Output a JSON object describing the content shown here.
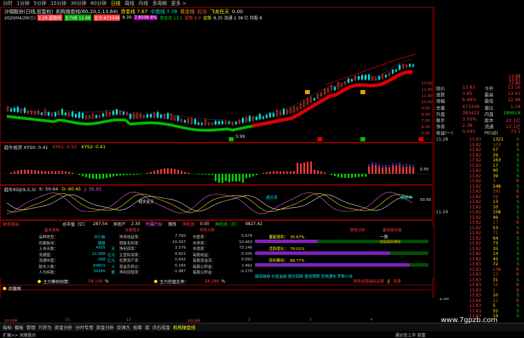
{
  "toolbar": {
    "items": [
      "分时",
      "1分钟",
      "5分钟",
      "15分钟",
      "30分钟",
      "60分钟",
      "日线",
      "周线",
      "月线",
      "多周期",
      "更多 >"
    ],
    "active": "日线"
  },
  "chart_header": {
    "line1_a": "沙钢股份(日线,前复权)",
    "line1_b": "机构操盘线(60,20,1,13,64)",
    "line1_c": "资金线 7.67",
    "line1_d": "中盘线 7.78",
    "line1_e": "黄金线",
    "line1_f": "起涨",
    "line1_g": "飞龙在天",
    "line1_h": "0.00",
    "line2_date": "2020/04/29(三)",
    "line2_a": "2.29 超级线 ",
    "line2_b": "主力线 11.98",
    "line2_c": "主力 673349",
    "line2_d": "8.39",
    "line2_e": "7.8598 8%",
    "line2_f": "资金流 13.1",
    "line2_g": "超叛 6.0",
    "line2_h": "金叛",
    "line2_i": "8.35 流通 2.38 亿 持股 8"
  },
  "price_axis": [
    "13.00",
    "12.00",
    "11.00",
    "10.00",
    "9.00",
    "8.00",
    "7.00",
    "6.00",
    "5.00"
  ],
  "main_annotations": {
    "bottom_label": "5.99",
    "markers": [
      "吸",
      "买",
      "卖",
      "买",
      "卖"
    ]
  },
  "pane2": {
    "header_a": "趋牛抢货 XYS0: 0.41",
    "header_b": "XYS1: 0.52",
    "header_c": "XYS2: 0.41",
    "axis": [
      "0.50",
      "1.00",
      "0.00"
    ]
  },
  "pane3": {
    "header_a": "趋牛KDJ(9,3,3)",
    "header_b": "K: 50.64",
    "header_c": "D: 60.45",
    "header_d": "J: 35.01",
    "labels": [
      "超卖金叉",
      "超卖金叉",
      "超买卖"
    ],
    "axis": [
      "100",
      "50.00",
      "0"
    ]
  },
  "finance": {
    "title": "财务指标",
    "total_shares": "总市值（亿）",
    "total_shares_v": "287.54",
    "net_asset_label": "净资产",
    "net_asset_v": "2.30",
    "industry_label": "所属行业",
    "industry_v": "钢铁",
    "profit_label": "净利润",
    "profit_v": "0.00",
    "profit_label2": "净利润（万）",
    "profit_v2": "9827.42",
    "sections": [
      "基本资料",
      "业绩增长",
      "财务分析",
      "财务分析",
      "基本面评级"
    ],
    "left": [
      {
        "k": "品种类型：",
        "v": "中小板",
        "u": ""
      },
      {
        "k": "所属板块：",
        "v": "钢铁",
        "u": ""
      },
      {
        "k": "上市天数：",
        "v": "4935",
        "u": "天"
      },
      {
        "k": "流通盘：",
        "v": "22.068",
        "u": "亿元"
      },
      {
        "k": "流通市值：",
        "v": "288",
        "u": "亿元"
      },
      {
        "k": "股东人数：",
        "v": "64601",
        "u": "人"
      },
      {
        "k": "人均持股：",
        "v": "34160",
        "u": "股"
      }
    ],
    "mid": [
      {
        "k": "净资收益率：",
        "v": "7.760"
      },
      {
        "k": "销售毛利率：",
        "v": "10.597"
      },
      {
        "k": "净利润率：",
        "v": "3.576"
      },
      {
        "k": "主营利润率：",
        "v": "8.601"
      },
      {
        "k": "优质资产率：",
        "v": "0.642"
      },
      {
        "k": "现金负债比：",
        "v": "0.165"
      },
      {
        "k": "净利润增率：",
        "v": "-1.987"
      }
    ],
    "right": [
      {
        "k": "市盈率：",
        "v": "5.676"
      },
      {
        "k": "市净率：",
        "v": "10.463"
      },
      {
        "k": "市销率：",
        "v": "73.146"
      },
      {
        "k": "每股收益：",
        "v": "0.045"
      },
      {
        "k": "每股资金流：",
        "v": "0.092"
      },
      {
        "k": "每股公积金：",
        "v": "1.492"
      },
      {
        "k": "每股公积金：",
        "v": "-0.276"
      }
    ],
    "main_profit_label": "主力筹码估算：",
    "main_profit_v": "58.106",
    "main_profit_u": "%",
    "main_cost_label": "主力控盘比率：",
    "main_cost_v": "58.286",
    "main_cost_u": "%",
    "bars": [
      {
        "label": "量能饱和：",
        "v": "35.67%",
        "fill": 0.36
      },
      {
        "label": "活跃度比：",
        "v": "78.01%",
        "fill": 0.78
      },
      {
        "label": "获利筹码：",
        "v": "88.77%",
        "fill": 0.89
      }
    ],
    "grade_top": "一般",
    "grade_desc": "有股假的满线",
    "bottom_note": "融资融券 价投金融 股份回购 重组预期 宝钢通信 罗数小说",
    "legend_a": "财务估值指标关联",
    "legend_b": "主",
    "legend_c": "资源"
  },
  "pane5": {
    "title": "四量图",
    "axis": "2.50"
  },
  "time_axis": [
    "2018年",
    "11",
    "12",
    "2019年",
    "2",
    "3",
    "4"
  ],
  "right_panel": {
    "rows": [
      {
        "k": "现价",
        "v": "13.83",
        "k2": "今开",
        "v2": "13.16"
      },
      {
        "k": "涨跌",
        "v": "0.85",
        "k2": "最高",
        "v2": "13.93"
      },
      {
        "k": "涨幅",
        "v": "6.98%",
        "k2": "最低",
        "v2": "12.98"
      },
      {
        "k": "总量",
        "v": "673349",
        "k2": "量比",
        "v2": "1.18"
      },
      {
        "k": "外盘",
        "v": "383422",
        "k2": "内盘",
        "v2": "289918"
      },
      {
        "k": "换手",
        "v": "3.05%",
        "k2": "股本",
        "v2": "22.1亿"
      },
      {
        "k": "净资",
        "v": "2.38",
        "k2": "流通",
        "v2": "22.1亿"
      },
      {
        "k": "收益(一)",
        "v": "0.045",
        "k2": "PE(动)",
        "v2": "73.1"
      }
    ],
    "partial_top": [
      "13.88",
      "13.87",
      "13.86"
    ],
    "ticks": [
      {
        "t": "11:28",
        "p": "13.83",
        "v": "1321",
        "s": "S"
      },
      {
        "t": "",
        "p": "13.82",
        "v": "103",
        "s": "B"
      },
      {
        "t": "",
        "p": "13.82",
        "v": "57",
        "s": "S"
      },
      {
        "t": "",
        "p": "13.82",
        "v": "29",
        "s": "S"
      },
      {
        "t": "",
        "p": "13.82",
        "v": "163",
        "s": "S"
      },
      {
        "t": "",
        "p": "13.83",
        "v": "17",
        "s": "S"
      },
      {
        "t": "",
        "p": "13.82",
        "v": "90",
        "s": "S"
      },
      {
        "t": "",
        "p": "13.82",
        "v": "39",
        "s": "S"
      },
      {
        "t": "",
        "p": "13.82",
        "v": "3",
        "s": "B"
      },
      {
        "t": "",
        "p": "13.82",
        "v": "248",
        "s": "S"
      },
      {
        "t": "",
        "p": "13.83",
        "v": "191",
        "s": "B"
      },
      {
        "t": "",
        "p": "13.82",
        "v": "59",
        "s": "B"
      },
      {
        "t": "",
        "p": "13.82",
        "v": "13",
        "s": "S"
      },
      {
        "t": "",
        "p": "13.82",
        "v": "10",
        "s": "S"
      },
      {
        "t": "11:29",
        "p": "13.82",
        "v": "158",
        "s": "S"
      },
      {
        "t": "",
        "p": "13.82",
        "v": "49",
        "s": "S"
      },
      {
        "t": "",
        "p": "13.82",
        "v": "17",
        "s": "B"
      },
      {
        "t": "",
        "p": "13.82",
        "v": "53",
        "s": "S"
      },
      {
        "t": "",
        "p": "13.82",
        "v": "71",
        "s": "B"
      },
      {
        "t": "",
        "p": "13.82",
        "v": "64",
        "s": "S"
      },
      {
        "t": "",
        "p": "13.82",
        "v": "73",
        "s": "S"
      },
      {
        "t": "",
        "p": "13.82",
        "v": "35",
        "s": "S"
      },
      {
        "t": "",
        "p": "13.82",
        "v": "14",
        "s": "S"
      },
      {
        "t": "",
        "p": "13.82",
        "v": "45",
        "s": "S"
      },
      {
        "t": "",
        "p": "13.83",
        "v": "72",
        "s": "S"
      },
      {
        "t": "",
        "p": "13.83",
        "v": "138",
        "s": "B"
      },
      {
        "t": "",
        "p": "13.83",
        "v": "13",
        "s": "B"
      },
      {
        "t": "",
        "p": "13.83",
        "v": "31",
        "s": "S"
      },
      {
        "t": "",
        "p": "13.83",
        "v": "12",
        "s": "B"
      },
      {
        "t": "",
        "p": "13.83",
        "v": "2",
        "s": "B"
      },
      {
        "t": "",
        "p": "13.83",
        "v": "10",
        "s": "S"
      },
      {
        "t": "",
        "p": "13.84",
        "v": "22",
        "s": "B"
      },
      {
        "t": "",
        "p": "13.83",
        "v": "5",
        "s": "S"
      },
      {
        "t": "",
        "p": "13.83",
        "v": "55",
        "s": "S"
      },
      {
        "t": "",
        "p": "13.83",
        "v": "14",
        "s": "S"
      }
    ]
  },
  "bottom_tabs": [
    "指标",
    "模板",
    "管理",
    "只存为",
    "资金分析",
    "分时专用",
    "资金分析",
    "反弹大",
    "抢筹",
    "扇",
    "点石成金",
    "机构操盘线"
  ],
  "bottom_tabs_active": "机构操盘线",
  "status": {
    "left": "扩展>> 关联股价",
    "right": "通达信上市 苗富"
  },
  "watermark": "www.7gpzb.com",
  "colors": {
    "up": "#ff3c3c",
    "down": "#00e600",
    "accent": "#ffff00",
    "border": "#8b0000"
  }
}
